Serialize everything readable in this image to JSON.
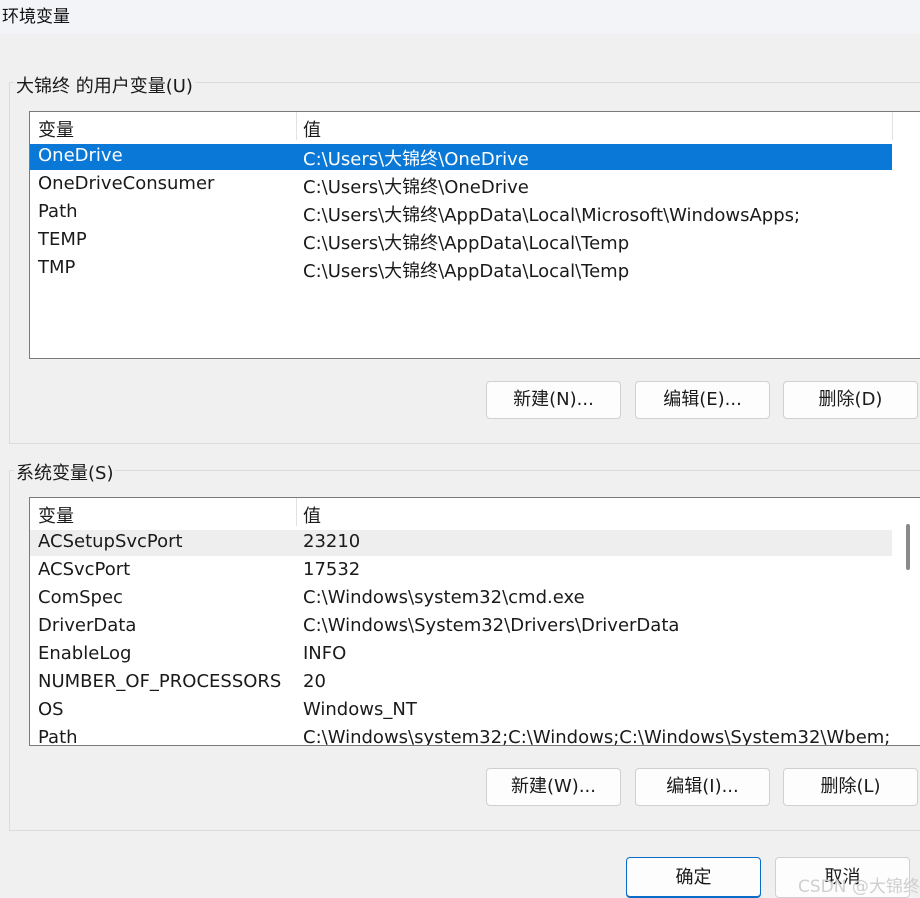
{
  "window": {
    "title": "环境变量"
  },
  "user_vars": {
    "legend": "大锦终 的用户变量(U)",
    "col_name": "变量",
    "col_value": "值",
    "rows": [
      {
        "name": "OneDrive",
        "value": "C:\\Users\\大锦终\\OneDrive"
      },
      {
        "name": "OneDriveConsumer",
        "value": "C:\\Users\\大锦终\\OneDrive"
      },
      {
        "name": "Path",
        "value": "C:\\Users\\大锦终\\AppData\\Local\\Microsoft\\WindowsApps;"
      },
      {
        "name": "TEMP",
        "value": "C:\\Users\\大锦终\\AppData\\Local\\Temp"
      },
      {
        "name": "TMP",
        "value": "C:\\Users\\大锦终\\AppData\\Local\\Temp"
      }
    ],
    "selected_row": "OneDrive",
    "buttons": {
      "new": "新建(N)...",
      "edit": "编辑(E)...",
      "delete": "删除(D)"
    }
  },
  "system_vars": {
    "legend": "系统变量(S)",
    "col_name": "变量",
    "col_value": "值",
    "rows": [
      {
        "name": "ACSetupSvcPort",
        "value": "23210"
      },
      {
        "name": "ACSvcPort",
        "value": "17532"
      },
      {
        "name": "ComSpec",
        "value": "C:\\Windows\\system32\\cmd.exe"
      },
      {
        "name": "DriverData",
        "value": "C:\\Windows\\System32\\Drivers\\DriverData"
      },
      {
        "name": "EnableLog",
        "value": "INFO"
      },
      {
        "name": "NUMBER_OF_PROCESSORS",
        "value": "20"
      },
      {
        "name": "OS",
        "value": "Windows_NT"
      },
      {
        "name": "Path",
        "value": "C:\\Windows\\system32;C:\\Windows;C:\\Windows\\System32\\Wbem;"
      }
    ],
    "buttons": {
      "new": "新建(W)...",
      "edit": "编辑(I)...",
      "delete": "删除(L)"
    }
  },
  "footer": {
    "ok": "确定",
    "cancel": "取消"
  },
  "watermark": "CSDN @大锦终",
  "colors": {
    "selection": "#0a78d7",
    "primary_border": "#0a6cc8"
  }
}
